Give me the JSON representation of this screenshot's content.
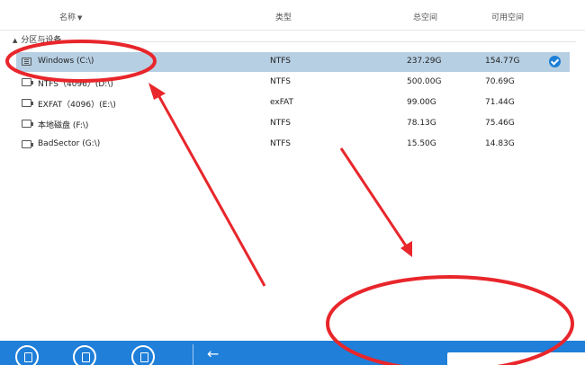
{
  "columns": {
    "name": "名称",
    "type": "类型",
    "total": "总空间",
    "free": "可用空间"
  },
  "group": {
    "label": "分区与设备"
  },
  "rows": [
    {
      "name": "Windows (C:\\)",
      "type": "NTFS",
      "total": "237.29G",
      "free": "154.77G",
      "selected": true,
      "icon": "system-drive-icon"
    },
    {
      "name": "NTFS（4096）(D:\\)",
      "type": "NTFS",
      "total": "500.00G",
      "free": "70.69G",
      "selected": false,
      "icon": "drive-icon"
    },
    {
      "name": "EXFAT（4096）(E:\\)",
      "type": "exFAT",
      "total": "99.00G",
      "free": "71.44G",
      "selected": false,
      "icon": "drive-icon"
    },
    {
      "name": "本地磁盘 (F:\\)",
      "type": "NTFS",
      "total": "78.13G",
      "free": "75.46G",
      "selected": false,
      "icon": "drive-icon"
    },
    {
      "name": "BadSector (G:\\)",
      "type": "NTFS",
      "total": "15.50G",
      "free": "14.83G",
      "selected": false,
      "icon": "drive-icon"
    }
  ],
  "colors": {
    "accent": "#1f7fd9",
    "selection": "#b7cfe3",
    "annotation": "#e8262b"
  },
  "bottombar": {
    "icons": [
      "drive-mode-icon",
      "location-pin-icon",
      "export-icon",
      "back-arrow-icon"
    ]
  }
}
